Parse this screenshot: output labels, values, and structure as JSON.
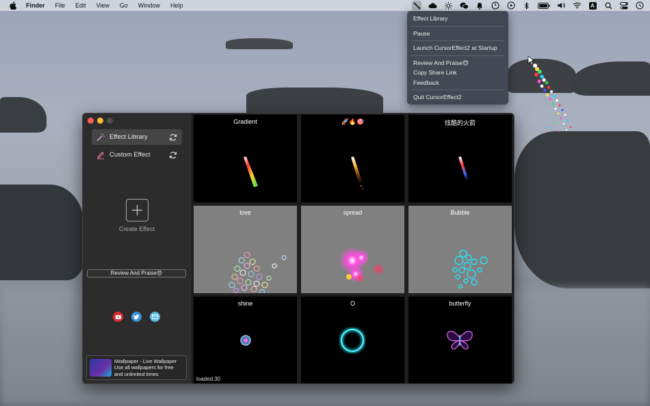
{
  "menubar": {
    "app_name": "Finder",
    "menus": [
      "File",
      "Edit",
      "View",
      "Go",
      "Window",
      "Help"
    ],
    "status_icons": [
      "cursor-effect-icon",
      "cloud-icon",
      "sun-icon",
      "wechat-icon",
      "bell-icon",
      "power-icon",
      "play-icon",
      "bluetooth-icon",
      "battery-icon",
      "volume-icon",
      "wifi-icon",
      "input-source-icon",
      "search-icon",
      "control-center-icon",
      "clock-icon"
    ],
    "input_source_label": "A"
  },
  "dropdown": {
    "effect_library": "Effect Library",
    "pause": "Pause",
    "launch_at_startup": "Launch CursorEffect2 at Startup",
    "review": "Review And Praise😍",
    "copy_share_link": "Copy Share Link",
    "feedback": "Feedback",
    "quit": "Quit CursorEffect2"
  },
  "sidebar": {
    "items": [
      {
        "label": "Effect Library",
        "icon": "magic-wand-icon",
        "selected": true
      },
      {
        "label": "Custom Effect",
        "icon": "pencil-icon",
        "selected": false
      }
    ],
    "create_label": "Create Effect",
    "review_button": "Review And Praise😍",
    "socials": [
      "youtube-icon",
      "twitter-icon",
      "mail-icon"
    ],
    "promo": {
      "line1": "iWallpaper - Live Wallpaper",
      "line2": "Use all wallpapers for free",
      "line3": "and unlimited times"
    }
  },
  "effects": [
    {
      "name": "Gradient",
      "bg": "black"
    },
    {
      "name": "🚀🔥🎯",
      "bg": "black"
    },
    {
      "name": "炫酷的火箭",
      "bg": "black"
    },
    {
      "name": "love",
      "bg": "gray"
    },
    {
      "name": "spread",
      "bg": "gray"
    },
    {
      "name": "Bubble",
      "bg": "gray"
    },
    {
      "name": "shine",
      "bg": "black"
    },
    {
      "name": "O",
      "bg": "black"
    },
    {
      "name": "butterfly",
      "bg": "black"
    }
  ],
  "status_text": "loaded:30",
  "colors": {
    "window_bg": "#1e1e1e",
    "sidebar_bg": "#2c2c2c",
    "menu_bg": "#3c424e",
    "accent_cyan": "#19e0f0"
  }
}
